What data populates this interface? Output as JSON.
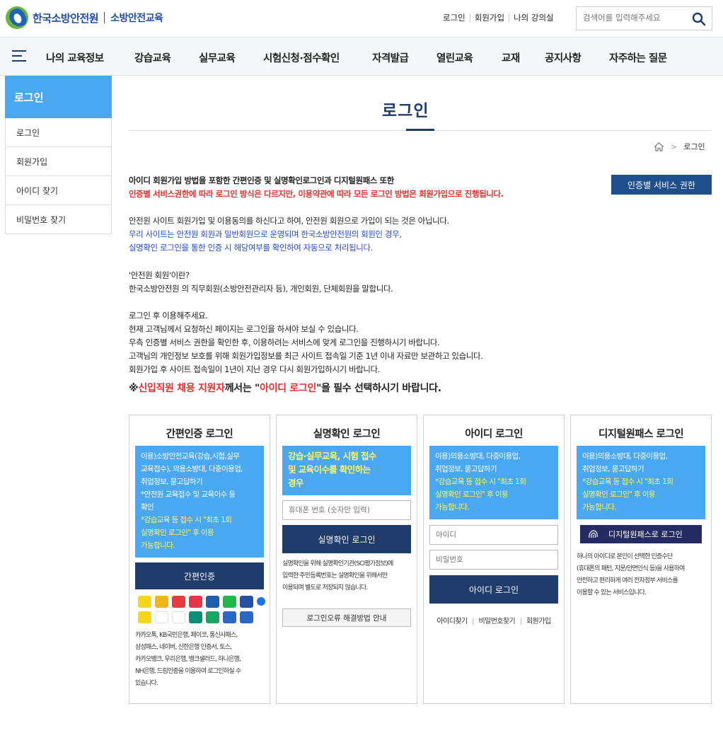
{
  "header": {
    "brand": "한국소방안전원",
    "brand_sub": "소방안전교육",
    "util": [
      "로그인",
      "회원가입",
      "나의 강의실"
    ],
    "search_placeholder": "검색어를 입력해주세요"
  },
  "gnb": [
    "나의 교육정보",
    "강습교육",
    "실무교육",
    "시험신청·점수확인",
    "자격발급",
    "열린교육",
    "교재",
    "공지사항",
    "자주하는 질문"
  ],
  "sidebar": {
    "title": "로그인",
    "items": [
      "로그인",
      "회원가입",
      "아이디 찾기",
      "비밀번호 찾기"
    ]
  },
  "main": {
    "title": "로그인",
    "breadcrumb": "로그인",
    "auth_button": "인증별 서비스 권한",
    "intro_bold": "아이디 회원가입 방법을 포함한 간편인증 및 실명확인로그인과 디지털원패스 또한",
    "intro_red": "인증별 서비스권한에 따라 로그인 방식은 다르지만, 이용약관에 따라 모든 로그인 방법은 회원가입으로 진행됩니다.",
    "p1": "안전원 사이트 회원가입 및 이용동의를 하신다고 하여, 안전원 회원으로 가입이 되는 것은 아닙니다.",
    "p2": "우리 사이트는 안전원 회원과 일반회원으로 운영되며 한국소방안전원의 회원인 경우,",
    "p3": "실명확인 로그인을 통한 인증 시 해당여부를 확인하여 자동으로 처리됩니다.",
    "p4": "'안전원 회원'이란?",
    "p5": "한국소방안전원 의 직무회원(소방안전관리자 등), 개인회원, 단체회원을 말합니다.",
    "p6": "로그인 후 이용해주세요.",
    "p7": "현재 고객님께서 요청하신 페이지는 로그인을 하셔야 보실 수 있습니다.",
    "p8": "우측 인증별 서비스 권한을 확인한 후, 이용하려는 서비스에 맞게 로그인을 진행하시기 바랍니다.",
    "p9": "고객님의 개인정보 보호를 위해 회원가입정보를 최근 사이트 접속일 기준 1년 이내 자료만 보관하고 있습니다.",
    "p10": "회원가입 후 사이트 접속일이 1년이 지난 경우 다시 회원가입하시기 바랍니다.",
    "notice_a": "※",
    "notice_b": "신입직원 채용 지원자",
    "notice_c": "께서는 \"",
    "notice_d": "아이디 로그인",
    "notice_e": "\"을 필수 선택하시기 바랍니다."
  },
  "cards": {
    "simple": {
      "title": "간편인증 로그인",
      "box": [
        "이용)소방안전교육(강습,시험,실무",
        "교육접수), 의용소방대, 다중이용업,",
        "취업정보, 묻고답하기",
        "*안전원 교육접수 및 교육이수 등",
        "확인"
      ],
      "box_yellow": [
        "*강습교육 등 접수 시 \"최초 1회",
        "실명확인 로그인\" 후 이용",
        "가능합니다."
      ],
      "button": "간편인증",
      "desc": [
        "카카오톡, KB국민은행, 페이코, 통신사패스,",
        "삼성패스, 네이버, 신한은행 인증서, 토스,",
        "카카오뱅크, 우리은행, 뱅크샐러드, 하나은행,",
        "NH은행, 드림인증을 이용하여 로그인하실 수",
        "있습니다."
      ]
    },
    "realname": {
      "title": "실명확인 로그인",
      "box": [
        "강습·실무교육, 시험 접수",
        "및 교육이수를 확인하는",
        "경우"
      ],
      "phone_placeholder": "휴대폰 번호 (숫자만 입력)",
      "button": "실명확인 로그인",
      "desc": [
        "실명확인을 위해 실명확인기관(SCI평가정보)에",
        "입력한 주민등록번호는 실명확인을 위해서만",
        "이용되며 별도로 저장되지 않습니다."
      ],
      "help_button": "로그인오류 해결방법 안내"
    },
    "id": {
      "title": "아이디 로그인",
      "box": [
        "이용)의용소방대, 다중이용업,",
        "취업정보, 묻고답하기"
      ],
      "box_yellow": [
        "*강습교육 등 접수 시 \"최초 1회",
        "실명확인 로그인\" 후 이용",
        "가능합니다."
      ],
      "id_placeholder": "아이디",
      "pw_placeholder": "비밀번호",
      "button": "아이디 로그인",
      "links": [
        "아이디찾기",
        "비밀번호찾기",
        "회원가입"
      ]
    },
    "onepass": {
      "title": "디지털원패스 로그인",
      "box": [
        "이용)의용소방대, 다중이용업,",
        "취업정보, 묻고답하기"
      ],
      "box_yellow": [
        "*강습교육 등 접수 시 \"최초 1회",
        "실명확인 로그인\" 후 이용",
        "가능합니다."
      ],
      "button": "디지털원패스로 로그인",
      "desc": [
        "하나의 아이디로 본인이 선택한 인증수단",
        "(휴대폰의 패턴, 지문/안면인식 등)을 사용하여",
        "안전하고 편리하게 여러 전자정부 서비스를",
        "이용할 수 있는 서비스입니다."
      ]
    }
  },
  "colors": {
    "accent": "#4aa8f2",
    "navy": "#1f3c6c",
    "red": "#e52e2e",
    "blue": "#2449c8",
    "yellow": "#fff46a"
  }
}
